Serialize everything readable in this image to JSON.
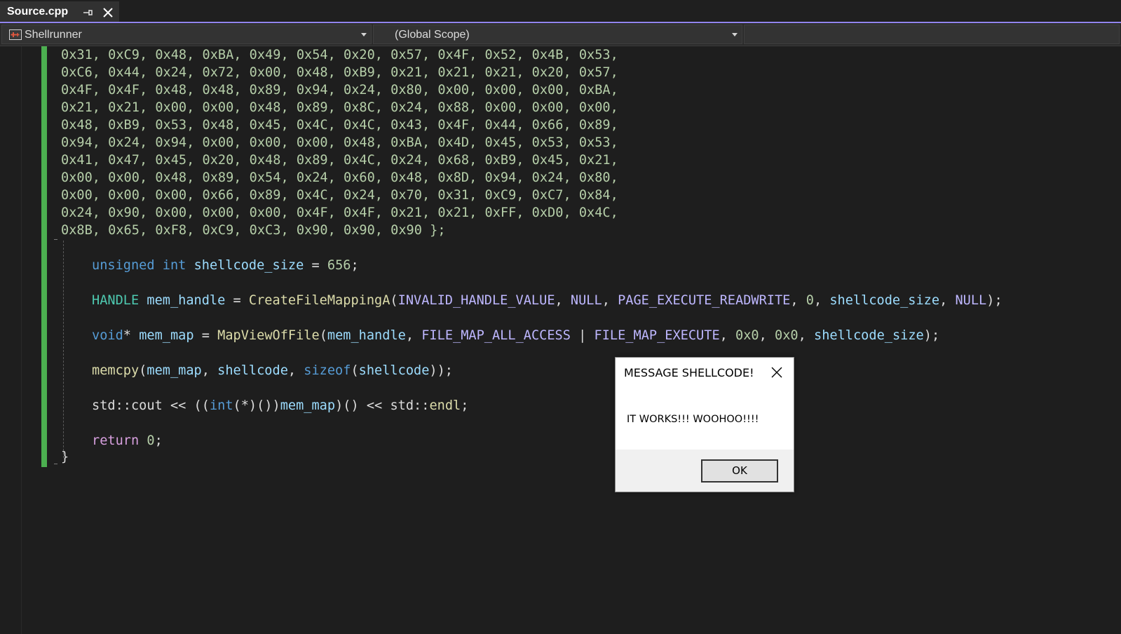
{
  "tab": {
    "title": "Source.cpp",
    "pin_icon": "pin-icon",
    "close_icon": "close-icon"
  },
  "navbar": {
    "project": "Shellrunner",
    "scope": "(Global Scope)",
    "third": ""
  },
  "code": {
    "hex_lines": [
      "0x31, 0xC9, 0x48, 0xBA, 0x49, 0x54, 0x20, 0x57, 0x4F, 0x52, 0x4B, 0x53,",
      "0xC6, 0x44, 0x24, 0x72, 0x00, 0x48, 0xB9, 0x21, 0x21, 0x21, 0x20, 0x57,",
      "0x4F, 0x4F, 0x48, 0x48, 0x89, 0x94, 0x24, 0x80, 0x00, 0x00, 0x00, 0xBA,",
      "0x21, 0x21, 0x00, 0x00, 0x48, 0x89, 0x8C, 0x24, 0x88, 0x00, 0x00, 0x00,",
      "0x48, 0xB9, 0x53, 0x48, 0x45, 0x4C, 0x4C, 0x43, 0x4F, 0x44, 0x66, 0x89,",
      "0x94, 0x24, 0x94, 0x00, 0x00, 0x00, 0x48, 0xBA, 0x4D, 0x45, 0x53, 0x53,",
      "0x41, 0x47, 0x45, 0x20, 0x48, 0x89, 0x4C, 0x24, 0x68, 0xB9, 0x45, 0x21,",
      "0x00, 0x00, 0x48, 0x89, 0x54, 0x24, 0x60, 0x48, 0x8D, 0x94, 0x24, 0x80,",
      "0x00, 0x00, 0x00, 0x66, 0x89, 0x4C, 0x24, 0x70, 0x31, 0xC9, 0xC7, 0x84,",
      "0x24, 0x90, 0x00, 0x00, 0x00, 0x4F, 0x4F, 0x21, 0x21, 0xFF, 0xD0, 0x4C,",
      "0x8B, 0x65, 0xF8, 0xC9, 0xC3, 0x90, 0x90, 0x90 };"
    ],
    "line_size": {
      "kw1": "unsigned",
      "kw2": "int",
      "var": "shellcode_size",
      "op": " = ",
      "num": "656",
      "end": ";"
    },
    "line_handle": {
      "type": "HANDLE",
      "var": "mem_handle",
      "op": " = ",
      "fn": "CreateFileMappingA",
      "open": "(",
      "a1": "INVALID_HANDLE_VALUE",
      "a2": "NULL",
      "a3": "PAGE_EXECUTE_READWRITE",
      "a4": "0",
      "a5": "shellcode_size",
      "a6": "NULL",
      "close": ");"
    },
    "line_map": {
      "kw": "void",
      "star": "*",
      "var": "mem_map",
      "op": " = ",
      "fn": "MapViewOfFile",
      "open": "(",
      "a1": "mem_handle",
      "a2": "FILE_MAP_ALL_ACCESS",
      "pipe": " | ",
      "a3": "FILE_MAP_EXECUTE",
      "a4": "0x0",
      "a5": "0x0",
      "a6": "shellcode_size",
      "close": ");"
    },
    "line_memcpy": {
      "fn": "memcpy",
      "open": "(",
      "a1": "mem_map",
      "a2": "shellcode",
      "kw": "sizeof",
      "open2": "(",
      "a3": "shellcode",
      "close": "));"
    },
    "line_cout": {
      "ns": "std",
      "sep": "::",
      "obj": "cout",
      "op": " << ((",
      "kw": "int",
      "cast": "(*)())",
      "var": "mem_map",
      "call": ")() << ",
      "ns2": "std",
      "sep2": "::",
      "endl": "endl",
      "end": ";"
    },
    "line_return": {
      "kw": "return",
      "num": "0",
      "end": ";"
    },
    "closing_brace": "}"
  },
  "dialog": {
    "title": "MESSAGE SHELLCODE!",
    "message": "IT WORKS!!! WOOHOO!!!!",
    "ok_label": "OK",
    "close_icon": "close-icon"
  },
  "colors": {
    "accent": "#9184ee",
    "change_bar": "#4caf50",
    "hex": "#b5cea8",
    "keyword": "#569cd6",
    "control": "#d8a0df",
    "variable": "#9cdcfe",
    "function": "#dcdcaa",
    "type": "#4ec9b0",
    "macro": "#bd63c5"
  }
}
